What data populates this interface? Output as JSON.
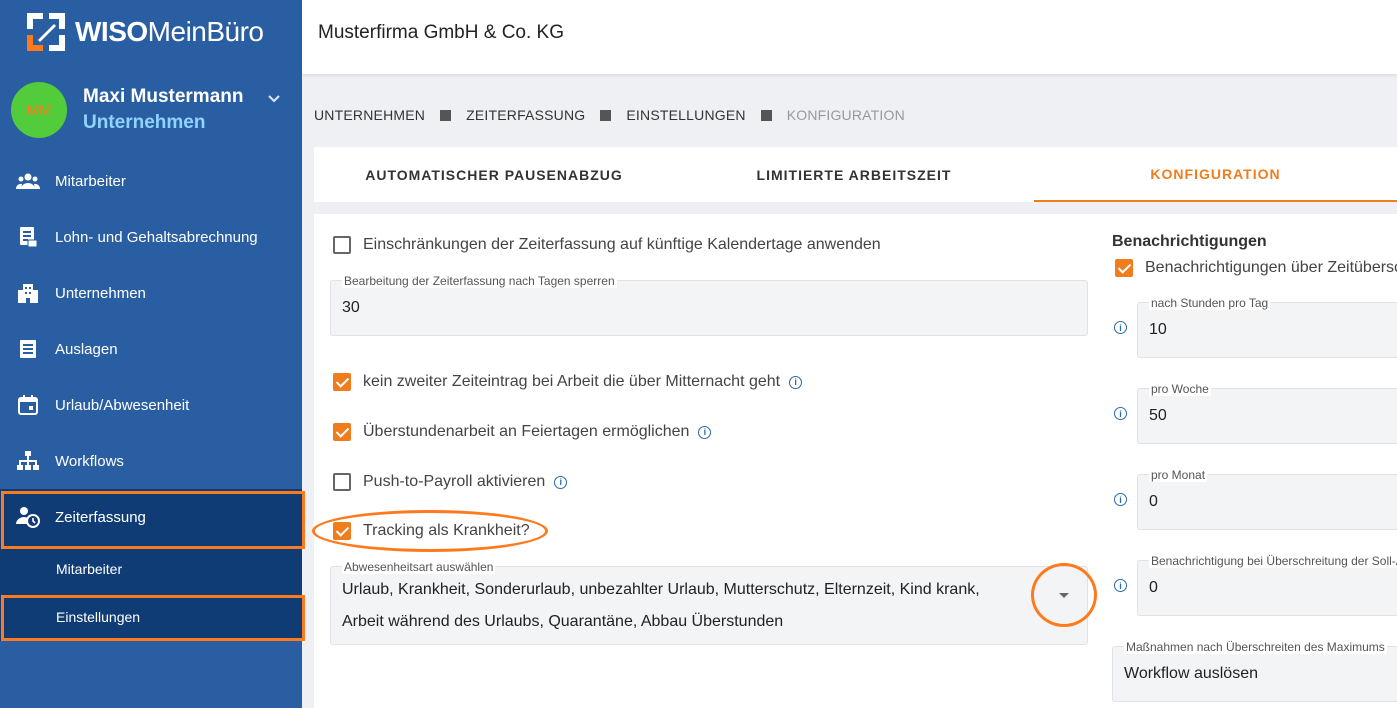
{
  "brand": {
    "name_bold": "WISO",
    "name_rest": "MeinBüro"
  },
  "user": {
    "initials": "MM",
    "name": "Maxi Mustermann",
    "role": "Unternehmen"
  },
  "nav": [
    {
      "label": "Mitarbeiter",
      "icon": "people-icon"
    },
    {
      "label": "Lohn- und Gehaltsabrechnung",
      "icon": "payroll-icon"
    },
    {
      "label": "Unternehmen",
      "icon": "building-icon"
    },
    {
      "label": "Auslagen",
      "icon": "receipt-icon"
    },
    {
      "label": "Urlaub/Abwesenheit",
      "icon": "calendar-icon"
    },
    {
      "label": "Workflows",
      "icon": "workflow-icon"
    },
    {
      "label": "Zeiterfassung",
      "icon": "time-tracking-icon"
    }
  ],
  "subnav": [
    {
      "label": "Mitarbeiter"
    },
    {
      "label": "Einstellungen"
    }
  ],
  "topbar": {
    "company": "Musterfirma GmbH & Co. KG"
  },
  "breadcrumb": [
    "UNTERNEHMEN",
    "ZEITERFASSUNG",
    "EINSTELLUNGEN",
    "KONFIGURATION"
  ],
  "tabs": [
    "AUTOMATISCHER PAUSENABZUG",
    "LIMITIERTE ARBEITSZEIT",
    "KONFIGURATION"
  ],
  "left": {
    "restrict_label": "Einschränkungen der Zeiterfassung auf künftige Kalendertage anwenden",
    "lock_days_label": "Bearbeitung der Zeiterfassung nach Tagen sperren",
    "lock_days_value": "30",
    "midnight_label": "kein zweiter Zeiteintrag bei Arbeit die über Mitternacht geht",
    "holiday_label": "Überstundenarbeit an Feiertagen ermöglichen",
    "payroll_label": "Push-to-Payroll aktivieren",
    "sick_label": "Tracking als Krankheit?",
    "absence_label": "Abwesenheitsart auswählen",
    "absence_line1": "Urlaub, Krankheit, Sonderurlaub, unbezahlter Urlaub, Mutterschutz, Elternzeit, Kind krank,",
    "absence_line2": "Arbeit während des Urlaubs, Quarantäne, Abbau Überstunden"
  },
  "right": {
    "title": "Benachrichtigungen",
    "overtime_label": "Benachrichtigungen über Zeitübersc",
    "per_day_label": "nach Stunden pro Tag",
    "per_day_value": "10",
    "per_week_label": "pro Woche",
    "per_week_value": "50",
    "per_month_label": "pro Monat",
    "per_month_value": "0",
    "target_label": "Benachrichtigung bei Überschreitung der Soll-A",
    "target_value": "0",
    "measures_label": "Maßnahmen nach Überschreiten des Maximums",
    "measures_value": "Workflow auslösen"
  },
  "colors": {
    "sidebar": "#2a5ea3",
    "sidebar_active": "#0f3c75",
    "accent": "#f07d1d",
    "highlight": "#ff7a1c"
  }
}
